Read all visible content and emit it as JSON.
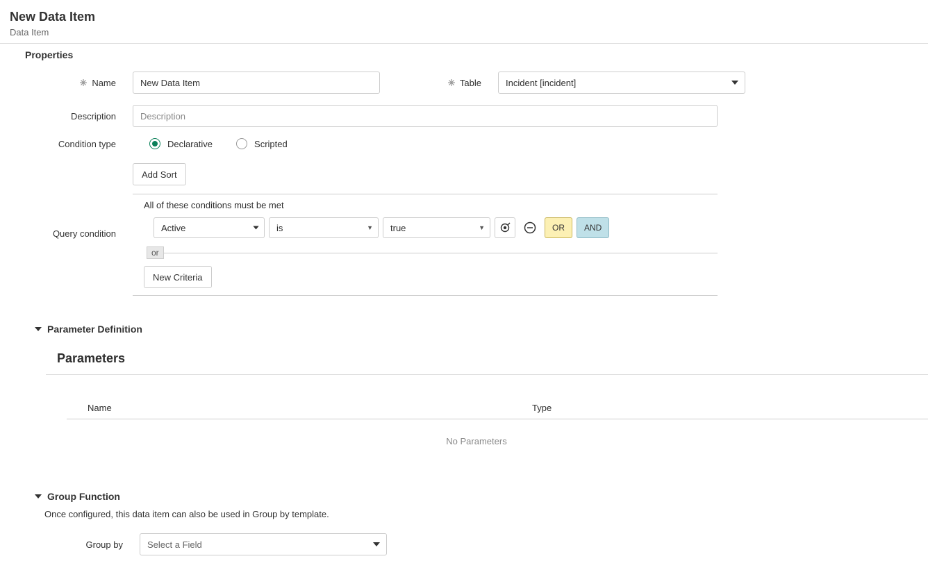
{
  "header": {
    "title": "New Data Item",
    "subtitle": "Data Item"
  },
  "sections": {
    "properties": "Properties",
    "parameterDefinition": "Parameter Definition",
    "groupFunction": "Group Function"
  },
  "fields": {
    "name": {
      "label": "Name",
      "value": "New Data Item"
    },
    "table": {
      "label": "Table",
      "value": "Incident [incident]"
    },
    "description": {
      "label": "Description",
      "placeholder": "Description"
    },
    "conditionType": {
      "label": "Condition type",
      "options": {
        "declarative": "Declarative",
        "scripted": "Scripted"
      },
      "selected": "declarative"
    },
    "queryCondition": {
      "label": "Query condition"
    },
    "groupBy": {
      "label": "Group by",
      "placeholder": "Select a Field"
    }
  },
  "condition": {
    "addSort": "Add Sort",
    "allMet": "All of these conditions must be met",
    "field": "Active",
    "operator": "is",
    "value": "true",
    "orLabel": "or",
    "newCriteria": "New Criteria",
    "orBtn": "OR",
    "andBtn": "AND"
  },
  "parameters": {
    "title": "Parameters",
    "cols": {
      "name": "Name",
      "type": "Type"
    },
    "empty": "No Parameters"
  },
  "group": {
    "help": "Once configured, this data item can also be used in Group by template."
  }
}
